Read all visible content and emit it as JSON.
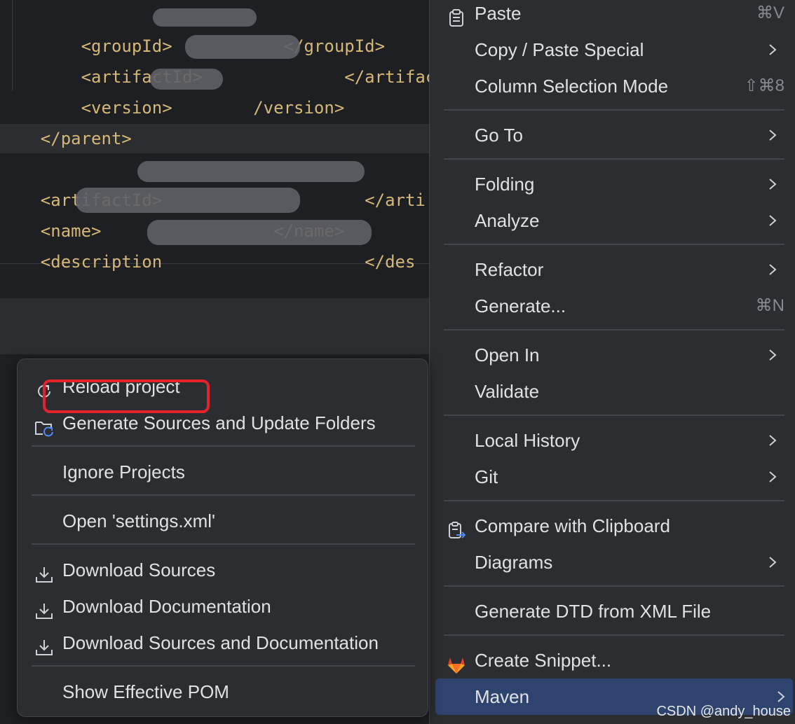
{
  "editor": {
    "lines": [
      "    <groupId>",
      "           </groupId>",
      "    <artifactId>",
      "              </artifactId",
      "    <version>",
      "        /version>",
      "</parent>",
      "<artifactId>",
      "                    </arti",
      "<name>",
      "                 </name>",
      "<description",
      "                    </des"
    ]
  },
  "context_menu": {
    "items": [
      {
        "label": "Paste",
        "shortcut": "⌘V",
        "icon": "clipboard-icon"
      },
      {
        "label": "Copy / Paste Special"
      },
      {
        "label": "Column Selection Mode",
        "shortcut": "⇧⌘8"
      },
      {
        "label": "Go To"
      },
      {
        "label": "Folding"
      },
      {
        "label": "Analyze"
      },
      {
        "label": "Refactor"
      },
      {
        "label": "Generate...",
        "shortcut": "⌘N"
      },
      {
        "label": "Open In"
      },
      {
        "label": "Validate"
      },
      {
        "label": "Local History"
      },
      {
        "label": "Git"
      },
      {
        "label": "Compare with Clipboard",
        "icon": "compare-clipboard-icon"
      },
      {
        "label": "Diagrams"
      },
      {
        "label": "Generate DTD from XML File"
      },
      {
        "label": "Create Snippet...",
        "icon": "gitlab-icon"
      },
      {
        "label": "Maven",
        "selected": true
      }
    ]
  },
  "maven_submenu": {
    "items": [
      {
        "label": "Reload project",
        "icon": "reload-icon",
        "highlighted": true
      },
      {
        "label": "Generate Sources and Update Folders",
        "icon": "folder-refresh-icon"
      },
      {
        "label": "Ignore Projects"
      },
      {
        "label": "Open 'settings.xml'"
      },
      {
        "label": "Download Sources",
        "icon": "download-icon"
      },
      {
        "label": "Download Documentation",
        "icon": "download-icon"
      },
      {
        "label": "Download Sources and Documentation",
        "icon": "download-icon"
      },
      {
        "label": "Show Effective POM"
      }
    ]
  },
  "colors": {
    "selection": "#2e436e",
    "highlight_border": "#e5222b",
    "xml_tag": "#d5b778",
    "menu_bg": "#2b2d30"
  },
  "watermark": "CSDN @andy_house"
}
